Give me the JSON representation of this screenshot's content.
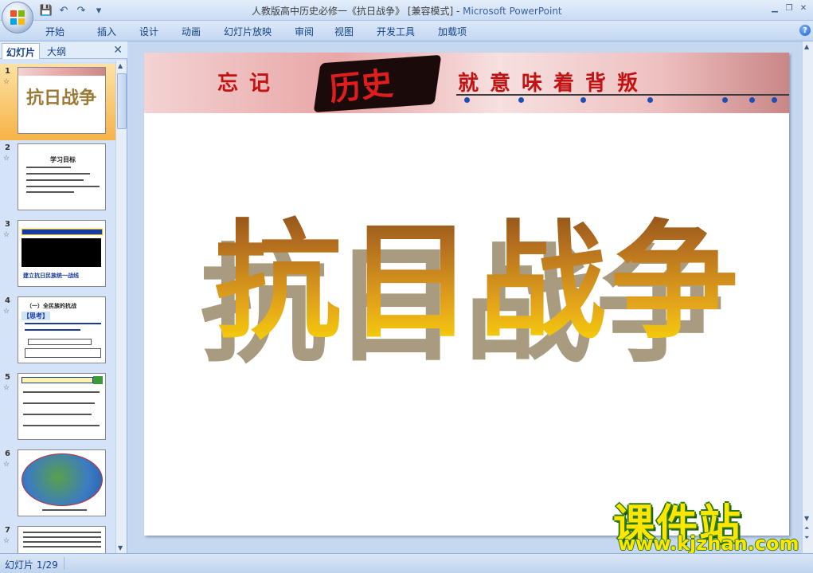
{
  "window": {
    "title_doc": "人教版高中历史必修一《抗日战争》 [兼容模式] - ",
    "title_app": "Microsoft PowerPoint"
  },
  "ribbon": {
    "tabs": [
      "开始",
      "插入",
      "设计",
      "动画",
      "幻灯片放映",
      "审阅",
      "视图",
      "开发工具",
      "加载项"
    ]
  },
  "pane": {
    "tab_slides": "幻灯片",
    "tab_outline": "大纲",
    "thumbnails": [
      {
        "num": "1",
        "mark": "☆",
        "text": "抗日战争"
      },
      {
        "num": "2",
        "mark": "☆",
        "text": "学习目标"
      },
      {
        "num": "3",
        "mark": "☆",
        "text": "建立抗日民族统一战线"
      },
      {
        "num": "4",
        "mark": "☆",
        "text": "（一）全民族的抗战"
      },
      {
        "num": "5",
        "mark": "☆",
        "text": ""
      },
      {
        "num": "6",
        "mark": "☆",
        "text": ""
      },
      {
        "num": "7",
        "mark": "☆",
        "text": ""
      }
    ],
    "thumb4_heading": "【思考】"
  },
  "slide": {
    "banner_left": "忘记",
    "banner_mid": "历史",
    "banner_right": "就意味着背叛",
    "title": "抗日战争"
  },
  "watermark": {
    "line1": "课件站",
    "line2": "www.kjzhan.com"
  },
  "status": {
    "slide_counter": "幻灯片 1/29"
  },
  "colors": {
    "accent": "#15428b",
    "banner_red": "#c21212",
    "selection": "#f6b347"
  }
}
